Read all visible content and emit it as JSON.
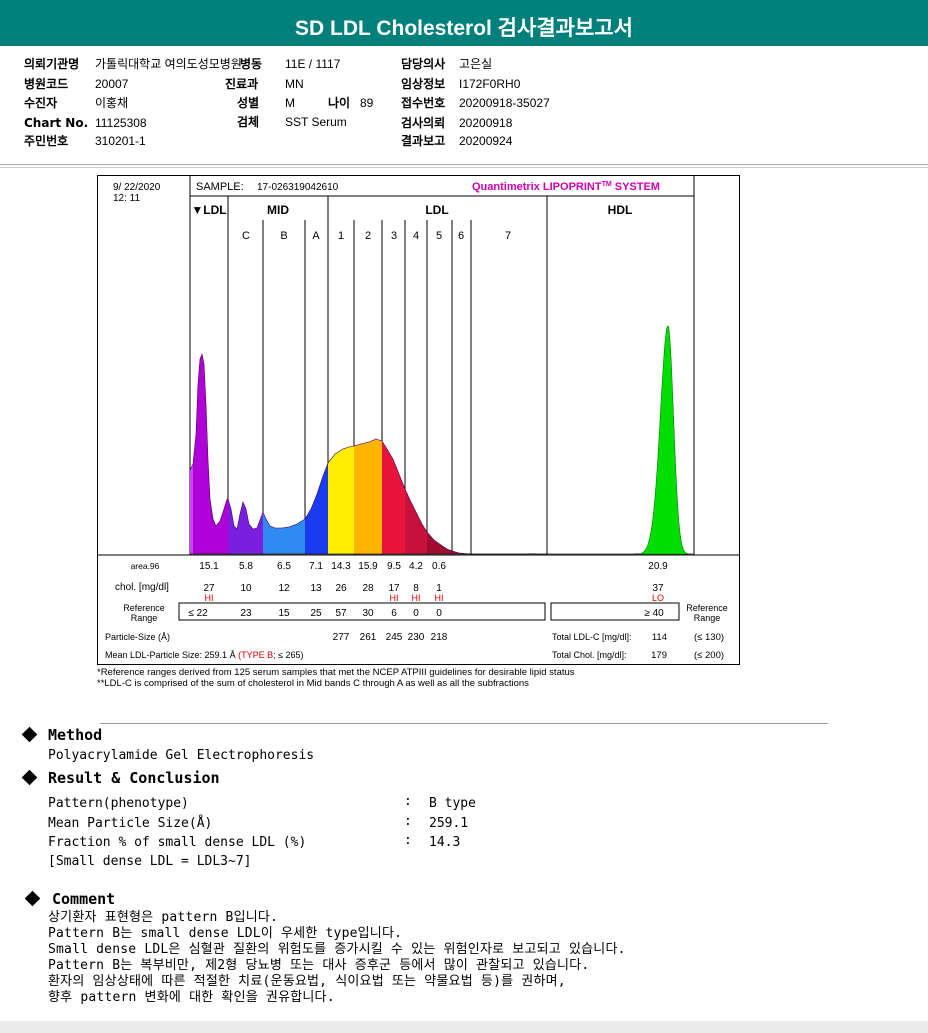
{
  "header": {
    "title": "SD LDL Cholesterol 검사결과보고서",
    "fields": {
      "institution_label": "의뢰기관명",
      "institution": "가톨릭대학교 여의도성모병원",
      "ward_label": "병동",
      "ward": "11E / 1117",
      "doctor_label": "담당의사",
      "doctor": "고은실",
      "hospital_code_label": "병원코드",
      "hospital_code": "20007",
      "department_label": "진료과",
      "department": "MN",
      "clinical_info_label": "임상정보",
      "clinical_info": "I172F0RH0",
      "patient_label": "수진자",
      "patient": "이홍채",
      "sex_label": "성별",
      "sex": "M",
      "age_label": "나이",
      "age": "89",
      "receipt_label": "접수번호",
      "receipt": "20200918-35027",
      "chart_no_label": "Chart No.",
      "chart_no": "11125308",
      "specimen_label": "검체",
      "specimen": "SST Serum",
      "test_request_label": "검사의뢰",
      "test_request": "20200918",
      "id_label": "주민번호",
      "id": "310201-1",
      "report_label": "결과보고",
      "report": "20200924"
    }
  },
  "chart_data": {
    "type": "area",
    "date": "9/ 22/2020",
    "time": "12: 11",
    "sample_label": "SAMPLE:",
    "sample_id": "17-026319042610",
    "system_name_pre": "Quantimetrix LIPOPRINT",
    "system_name_tm": "TM",
    "system_name_post": " SYSTEM",
    "band_groups": [
      "VLDL",
      "MID",
      "LDL",
      "HDL"
    ],
    "bands": [
      "C",
      "B",
      "A",
      "1",
      "2",
      "3",
      "4",
      "5",
      "6",
      "7"
    ],
    "row_labels": {
      "area": "area.96",
      "chol": "chol. [mg/dl]",
      "ref_line1": "Reference",
      "ref_line2": "Range",
      "ref_right_line1": "Reference",
      "ref_right_line2": "Range",
      "particle": "Particle-Size (Å)",
      "mean": "Mean LDL-Particle Size:"
    },
    "fractions": [
      {
        "name": "VLDL",
        "area": "15.1",
        "chol": "27",
        "flag": "HI",
        "ref": "≤  22",
        "color": "#b000d8"
      },
      {
        "name": "C",
        "area": "5.8",
        "chol": "10",
        "flag": "",
        "ref": "23",
        "color": "#7a1fe0"
      },
      {
        "name": "B",
        "area": "6.5",
        "chol": "12",
        "flag": "",
        "ref": "15",
        "color": "#2e8cf0"
      },
      {
        "name": "A",
        "area": "7.1",
        "chol": "13",
        "flag": "",
        "ref": "25",
        "color": "#1a3cf0"
      },
      {
        "name": "1",
        "area": "14.3",
        "chol": "26",
        "flag": "",
        "ref": "57",
        "size": "277",
        "color": "#ffee00"
      },
      {
        "name": "2",
        "area": "15.9",
        "chol": "28",
        "flag": "",
        "ref": "30",
        "size": "261",
        "color": "#ffb400"
      },
      {
        "name": "3",
        "area": "9.5",
        "chol": "17",
        "flag": "HI",
        "ref": "6",
        "size": "245",
        "color": "#e8143c"
      },
      {
        "name": "4",
        "area": "4.2",
        "chol": "8",
        "flag": "HI",
        "ref": "0",
        "size": "230",
        "color": "#c8103c"
      },
      {
        "name": "5",
        "area": "0.6",
        "chol": "1",
        "flag": "HI",
        "ref": "0",
        "size": "218",
        "color": "#a00c30"
      },
      {
        "name": "HDL",
        "area": "20.9",
        "chol": "37",
        "flag": "LO",
        "ref": "≥ 40",
        "color": "#00dd00"
      }
    ],
    "mean_particle_size": "259.1 Å",
    "mean_type": "(TYPE B",
    "mean_type_ref": "; ≤ 265)",
    "total_ldl_label": "Total LDL-C [mg/dl]:",
    "total_ldl": "114",
    "total_ldl_ref": "(≤ 130)",
    "total_chol_label": "Total Chol. [mg/dl]:",
    "total_chol": "179",
    "total_chol_ref": "(≤ 200)"
  },
  "footnotes": [
    "*Reference ranges derived from 125 serum samples that met the NCEP ATPIII guidelines for desirable lipid status",
    "**LDL-C is comprised of the sum of cholesterol in Mid bands C through A as well as all the subfractions"
  ],
  "method": {
    "title": "Method",
    "text": "Polyacrylamide Gel Electrophoresis"
  },
  "result": {
    "title": "Result & Conclusion",
    "rows": [
      {
        "label": "Pattern(phenotype)",
        "sep": ":",
        "value": "B type"
      },
      {
        "label": "Mean Particle Size(Å)",
        "sep": ":",
        "value": "259.1"
      },
      {
        "label": "Fraction % of small dense LDL (%)",
        "sep": ":",
        "value": "14.3"
      }
    ],
    "note": "[Small dense LDL = LDL3~7]"
  },
  "comment": {
    "title": "Comment",
    "lines": [
      "상기환자 표현형은 pattern B입니다.",
      "Pattern B는 small dense LDL이 우세한 type입니다.",
      "Small dense LDL은 심혈관 질환의 위험도를 증가시킬 수 있는 위험인자로 보고되고 있습니다.",
      "Pattern B는 복부비만, 제2형 당뇨병 또는 대사 증후군 등에서 많이 관찰되고 있습니다.",
      "환자의 임상상태에 따른 적절한 치료(운동요법, 식이요법 또는 약물요법 등)를 권하며,",
      "향후 pattern 변화에 대한 확인을 권유합니다."
    ]
  }
}
